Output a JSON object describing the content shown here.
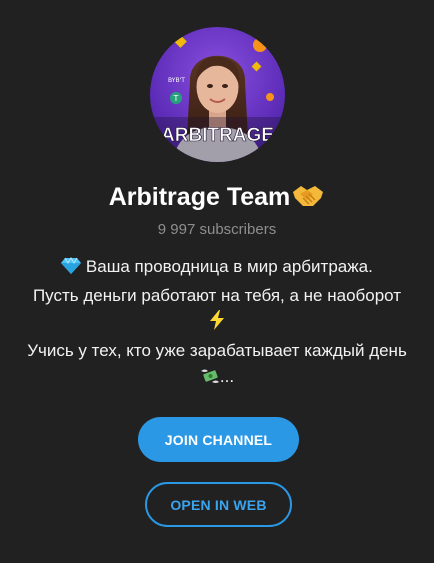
{
  "channel": {
    "avatar_caption": "ARBITRAGE",
    "title": "Arbitrage Team",
    "title_icon": "handshake-emoji",
    "subscribers": "9 997 subscribers",
    "description": {
      "line1_icon": "gem-emoji",
      "line1": "Ваша проводница в мир арбитража.",
      "line2": "Пусть деньги работают на тебя, а не наоборот",
      "line3_icon": "lightning-emoji",
      "line4": "Учись у тех, кто уже зарабатывает каждый день",
      "line5_icon": "money-with-wings-emoji",
      "line5": "..."
    }
  },
  "actions": {
    "join_label": "JOIN CHANNEL",
    "web_label": "OPEN IN WEB"
  },
  "colors": {
    "background": "#212121",
    "accent": "#2b98e5",
    "muted_text": "#8e8e8e"
  }
}
